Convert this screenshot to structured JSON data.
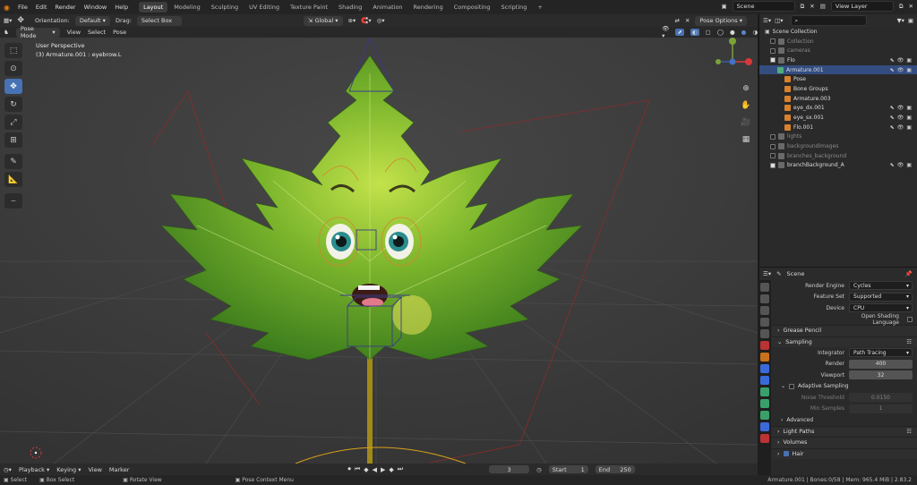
{
  "menu": [
    "File",
    "Edit",
    "Render",
    "Window",
    "Help"
  ],
  "workspaces": [
    "Layout",
    "Modeling",
    "Sculpting",
    "UV Editing",
    "Texture Paint",
    "Shading",
    "Animation",
    "Rendering",
    "Compositing",
    "Scripting"
  ],
  "active_workspace": "Layout",
  "scene_name": "Scene",
  "view_layer": "View Layer",
  "vp_toolbar": {
    "orientation_label": "Orientation:",
    "orientation": "Default",
    "drag_label": "Drag:",
    "drag": "Select Box",
    "transform": "Global",
    "pose_options": "Pose Options"
  },
  "vp_header": {
    "mode": "Pose Mode",
    "view": "View",
    "select": "Select",
    "pose": "Pose"
  },
  "overlay_text": {
    "perspective": "User Perspective",
    "object": "(3) Armature.001 : eyebrow.L"
  },
  "outliner": {
    "root": "Scene Collection",
    "rows": [
      {
        "label": "Collection",
        "indent": 1,
        "dim": true,
        "chk": true
      },
      {
        "label": "cameras",
        "indent": 1,
        "dim": true,
        "chk": true
      },
      {
        "label": "Flo",
        "indent": 1,
        "chk": true,
        "on": true,
        "vis": true
      },
      {
        "label": "Armature.001",
        "indent": 2,
        "sel": true,
        "vis": true
      },
      {
        "label": "Pose",
        "indent": 3
      },
      {
        "label": "Bone Groups",
        "indent": 3
      },
      {
        "label": "Armature.003",
        "indent": 3
      },
      {
        "label": "eye_dx.001",
        "indent": 3,
        "vis": true
      },
      {
        "label": "eye_sx.001",
        "indent": 3,
        "vis": true
      },
      {
        "label": "Flo.001",
        "indent": 3,
        "vis": true
      },
      {
        "label": "lights",
        "indent": 1,
        "dim": true,
        "chk": true
      },
      {
        "label": "backgroundImages",
        "indent": 1,
        "dim": true,
        "chk": true
      },
      {
        "label": "branches_background",
        "indent": 1,
        "dim": true,
        "chk": true
      },
      {
        "label": "branchBackground_A",
        "indent": 1,
        "chk": true,
        "on": true,
        "vis": true
      }
    ]
  },
  "props": {
    "header": "Scene",
    "render_engine_label": "Render Engine",
    "render_engine": "Cycles",
    "feature_set_label": "Feature Set",
    "feature_set": "Supported",
    "device_label": "Device",
    "device": "CPU",
    "osl_label": "Open Shading Language",
    "grease_pencil": "Grease Pencil",
    "sampling": "Sampling",
    "integrator_label": "Integrator",
    "integrator": "Path Tracing",
    "render_label": "Render",
    "render_samples": "400",
    "viewport_label": "Viewport",
    "viewport_samples": "32",
    "adaptive": "Adaptive Sampling",
    "noise_threshold_label": "Noise Threshold",
    "noise_threshold": "0.0150",
    "min_samples_label": "Min Samples",
    "min_samples": "1",
    "advanced": "Advanced",
    "light_paths": "Light Paths",
    "volumes": "Volumes",
    "hair": "Hair"
  },
  "timeline": {
    "playback": "Playback",
    "keying": "Keying",
    "view": "View",
    "marker": "Marker",
    "current_frame": "3",
    "start_label": "Start",
    "start": "1",
    "end_label": "End",
    "end": "250"
  },
  "status": {
    "select": "Select",
    "box_select": "Box Select",
    "rotate_view": "Rotate View",
    "pose_context": "Pose Context Menu",
    "stats": "Armature.001 | Bones:0/58 | Mem: 965.4 MiB | 2.83.2"
  }
}
